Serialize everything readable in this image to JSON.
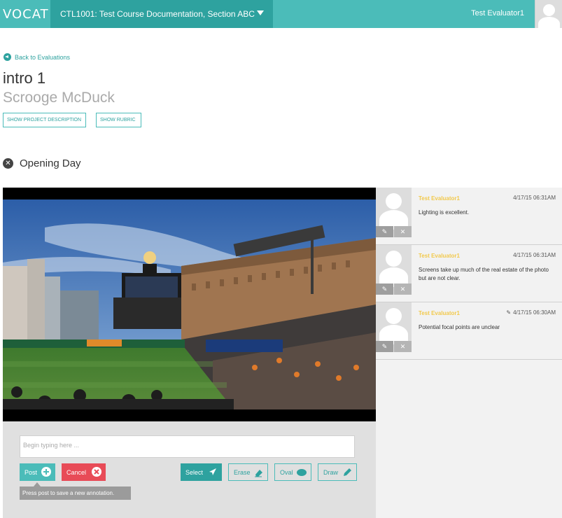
{
  "topbar": {
    "logo": "VOCAT",
    "course": "CTL1001: Test Course Documentation, Section ABC",
    "user": "Test Evaluator1"
  },
  "header": {
    "back_label": "Back to Evaluations",
    "title": "intro 1",
    "subtitle": "Scrooge McDuck",
    "show_description": "SHOW PROJECT DESCRIPTION",
    "show_rubric": "SHOW RUBRIC"
  },
  "media": {
    "title": "Opening Day"
  },
  "editor": {
    "placeholder": "Begin typing here ...",
    "post": "Post",
    "cancel": "Cancel",
    "select": "Select",
    "erase": "Erase",
    "oval": "Oval",
    "draw": "Draw",
    "tooltip": "Press post to save a new annotation."
  },
  "annotations": [
    {
      "author": "Test Evaluator1",
      "time": "4/17/15 06:31AM",
      "text": "Lighting is excellent.",
      "edited": false
    },
    {
      "author": "Test Evaluator1",
      "time": "4/17/15 06:31AM",
      "text": "Screens take up much of the real estate of the photo but are not clear.",
      "edited": false
    },
    {
      "author": "Test Evaluator1",
      "time": "4/17/15 06:30AM",
      "text": "Potential focal points are unclear",
      "edited": true
    }
  ],
  "colors": {
    "brand": "#4bbcb9",
    "brand_dark": "#2ea29f",
    "cancel": "#e84b57",
    "author": "#f2c94c"
  },
  "icons": [
    "back-arrow-icon",
    "caret-down-icon",
    "user-avatar-icon",
    "close-icon",
    "plus-icon",
    "cancel-x-icon",
    "cursor-icon",
    "eraser-icon",
    "oval-icon",
    "pencil-icon",
    "edit-icon",
    "delete-icon"
  ]
}
